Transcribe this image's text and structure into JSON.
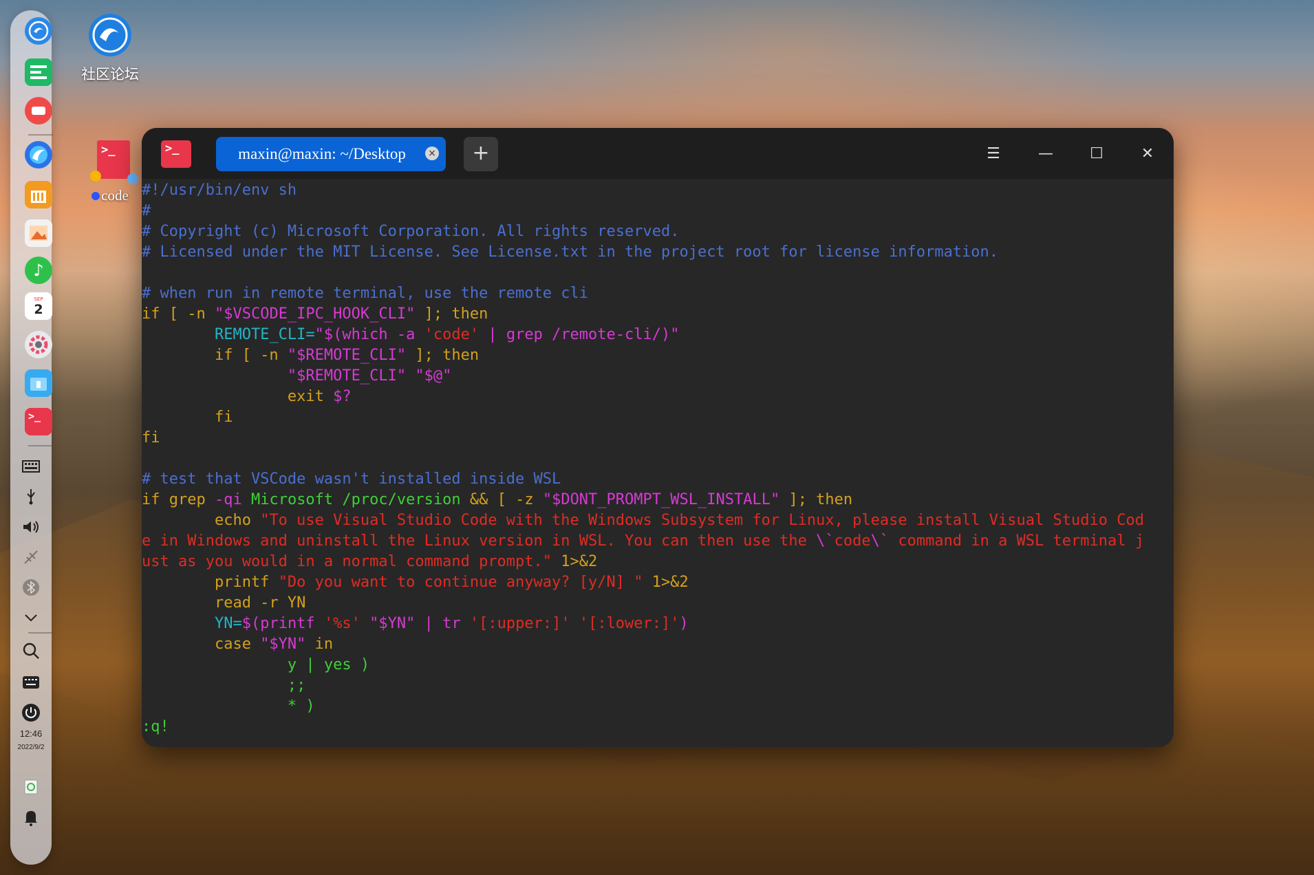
{
  "desktop": {
    "icons": [
      {
        "label": "社区论坛",
        "icon": "deepin-forum-icon"
      },
      {
        "label": "code",
        "icon": "terminal-shortcut-icon"
      }
    ]
  },
  "dock": {
    "clock_time": "12:46",
    "clock_date": "2022/9/2",
    "calendar_month": "SEP",
    "calendar_day": "2",
    "apps": [
      "launcher-icon",
      "multitasking-icon",
      "screen-recorder-icon",
      "browser-icon",
      "app-store-icon",
      "image-viewer-icon",
      "music-icon",
      "calendar-icon",
      "settings-icon",
      "file-manager-icon",
      "terminal-icon"
    ],
    "tray": [
      "keyboard-layout-icon",
      "usb-icon",
      "volume-icon",
      "network-icon",
      "bluetooth-icon",
      "chevron-down-icon",
      "search-icon",
      "onscreen-keyboard-icon",
      "power-icon",
      "trash-icon",
      "notification-icon"
    ]
  },
  "terminal": {
    "tab_title": "maxin@maxin: ~/Desktop",
    "new_tab": "+",
    "menu_icon": "☰",
    "minimize_icon": "—",
    "maximize_icon": "☐",
    "close_icon": "✕",
    "app_glyph": ">_",
    "lines": [
      [
        {
          "t": "#!/usr/bin/env sh",
          "c": "c-com"
        }
      ],
      [
        {
          "t": "#",
          "c": "c-com"
        }
      ],
      [
        {
          "t": "# Copyright (c) Microsoft Corporation. All rights reserved.",
          "c": "c-com"
        }
      ],
      [
        {
          "t": "# Licensed under the MIT License. See License.txt in the project root for license information.",
          "c": "c-com"
        }
      ],
      [],
      [
        {
          "t": "# when run in remote terminal, use the remote cli",
          "c": "c-com"
        }
      ],
      [
        {
          "t": "if [ -n ",
          "c": "c-kw"
        },
        {
          "t": "\"",
          "c": "c-mag"
        },
        {
          "t": "$VSCODE_IPC_HOOK_CLI",
          "c": "c-mag"
        },
        {
          "t": "\"",
          "c": "c-mag"
        },
        {
          "t": " ]; then",
          "c": "c-kw"
        }
      ],
      [
        {
          "t": "        ",
          "c": ""
        },
        {
          "t": "REMOTE_CLI=",
          "c": "c-cyn"
        },
        {
          "t": "\"$(which -a ",
          "c": "c-mag"
        },
        {
          "t": "'code'",
          "c": "c-str"
        },
        {
          "t": " | grep /remote-cli/)\"",
          "c": "c-mag"
        }
      ],
      [
        {
          "t": "        if [ -n ",
          "c": "c-kw"
        },
        {
          "t": "\"$REMOTE_CLI\"",
          "c": "c-mag"
        },
        {
          "t": " ]; then",
          "c": "c-kw"
        }
      ],
      [
        {
          "t": "                ",
          "c": ""
        },
        {
          "t": "\"$REMOTE_CLI\" \"$@\"",
          "c": "c-mag"
        }
      ],
      [
        {
          "t": "                exit ",
          "c": "c-kw"
        },
        {
          "t": "$?",
          "c": "c-mag"
        }
      ],
      [
        {
          "t": "        fi",
          "c": "c-kw"
        }
      ],
      [
        {
          "t": "fi",
          "c": "c-kw"
        }
      ],
      [],
      [
        {
          "t": "# test that VSCode wasn't installed inside WSL",
          "c": "c-com"
        }
      ],
      [
        {
          "t": "if grep ",
          "c": "c-kw"
        },
        {
          "t": "-qi",
          "c": "c-mag"
        },
        {
          "t": " Microsoft /proc/version",
          "c": "c-grn"
        },
        {
          "t": " && [ -z ",
          "c": "c-kw"
        },
        {
          "t": "\"$DONT_PROMPT_WSL_INSTALL\"",
          "c": "c-mag"
        },
        {
          "t": " ]; then",
          "c": "c-kw"
        }
      ],
      [
        {
          "t": "        echo ",
          "c": "c-kw"
        },
        {
          "t": "\"To use Visual Studio Code with the Windows Subsystem for Linux, please install Visual Studio Cod",
          "c": "c-str"
        }
      ],
      [
        {
          "t": "e in Windows and uninstall the Linux version in WSL. You can then use the ",
          "c": "c-str"
        },
        {
          "t": "\\`",
          "c": "c-mag"
        },
        {
          "t": "code",
          "c": "c-str"
        },
        {
          "t": "\\`",
          "c": "c-mag"
        },
        {
          "t": " command in a WSL terminal j",
          "c": "c-str"
        }
      ],
      [
        {
          "t": "ust as you would in a normal command prompt.\"",
          "c": "c-str"
        },
        {
          "t": " 1>&2",
          "c": "c-kw"
        }
      ],
      [
        {
          "t": "        printf ",
          "c": "c-kw"
        },
        {
          "t": "\"Do you want to continue anyway? [y/N] \"",
          "c": "c-str"
        },
        {
          "t": " 1>&2",
          "c": "c-kw"
        }
      ],
      [
        {
          "t": "        read -r YN",
          "c": "c-kw"
        }
      ],
      [
        {
          "t": "        ",
          "c": ""
        },
        {
          "t": "YN=",
          "c": "c-cyn"
        },
        {
          "t": "$(printf ",
          "c": "c-mag"
        },
        {
          "t": "'%s'",
          "c": "c-str"
        },
        {
          "t": " \"$YN\" | tr ",
          "c": "c-mag"
        },
        {
          "t": "'[:upper:]'",
          "c": "c-str"
        },
        {
          "t": " ",
          "c": ""
        },
        {
          "t": "'[:lower:]'",
          "c": "c-str"
        },
        {
          "t": ")",
          "c": "c-mag"
        }
      ],
      [
        {
          "t": "        case ",
          "c": "c-kw"
        },
        {
          "t": "\"$YN\"",
          "c": "c-mag"
        },
        {
          "t": " in",
          "c": "c-kw"
        }
      ],
      [
        {
          "t": "                y | yes )",
          "c": "c-grn"
        }
      ],
      [
        {
          "t": "                ;;",
          "c": "c-grn"
        }
      ],
      [
        {
          "t": "                * )",
          "c": "c-grn"
        }
      ],
      [
        {
          "t": ":q!",
          "c": "c-grn"
        }
      ]
    ]
  }
}
